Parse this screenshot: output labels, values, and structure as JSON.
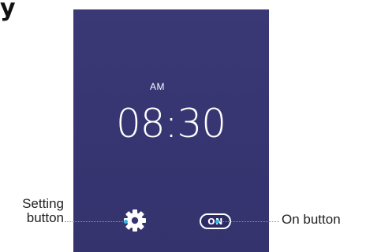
{
  "corner_glyph": "y",
  "clock": {
    "ampm": "AM",
    "time": "08:30"
  },
  "buttons": {
    "setting_icon": "gear-icon",
    "on_label": "ON"
  },
  "callouts": {
    "setting_line1": "Setting",
    "setting_line2": "button",
    "on": "On button"
  },
  "colors": {
    "screen_bg": "#3a3875",
    "callout_accent": "#2fb6e6",
    "text_light": "#ffffff"
  }
}
